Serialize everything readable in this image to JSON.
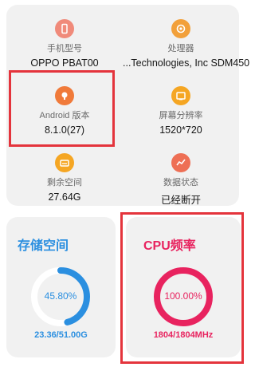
{
  "info": {
    "items": [
      {
        "label": "手机型号",
        "value": "OPPO PBAT00",
        "icon": "phone-icon"
      },
      {
        "label": "处理器",
        "value": "...Technologies, Inc SDM450",
        "icon": "processor-icon"
      },
      {
        "label": "Android 版本",
        "value": "8.1.0(27)",
        "icon": "android-icon"
      },
      {
        "label": "屏幕分辨率",
        "value": "1520*720",
        "icon": "screen-resolution-icon"
      },
      {
        "label": "剩余空间",
        "value": "27.64G",
        "icon": "storage-space-icon"
      },
      {
        "label": "数据状态",
        "value": "已经断开",
        "icon": "data-status-icon"
      }
    ]
  },
  "storage": {
    "title": "存储空间",
    "percent_text": "45.80%",
    "fraction": 0.458,
    "detail": "23.36/51.00G",
    "accent": "#2b8fe0"
  },
  "cpu": {
    "title": "CPU频率",
    "percent_text": "100.00%",
    "fraction": 1.0,
    "detail": "1804/1804MHz",
    "accent": "#e8235f"
  },
  "colors": {
    "phone": "#f08a7a",
    "processor": "#f2a03a",
    "android": "#f07a3a",
    "screen": "#f5a623",
    "storage_icon": "#f5a623",
    "data": "#ee6f55",
    "highlight": "#e4343c"
  }
}
